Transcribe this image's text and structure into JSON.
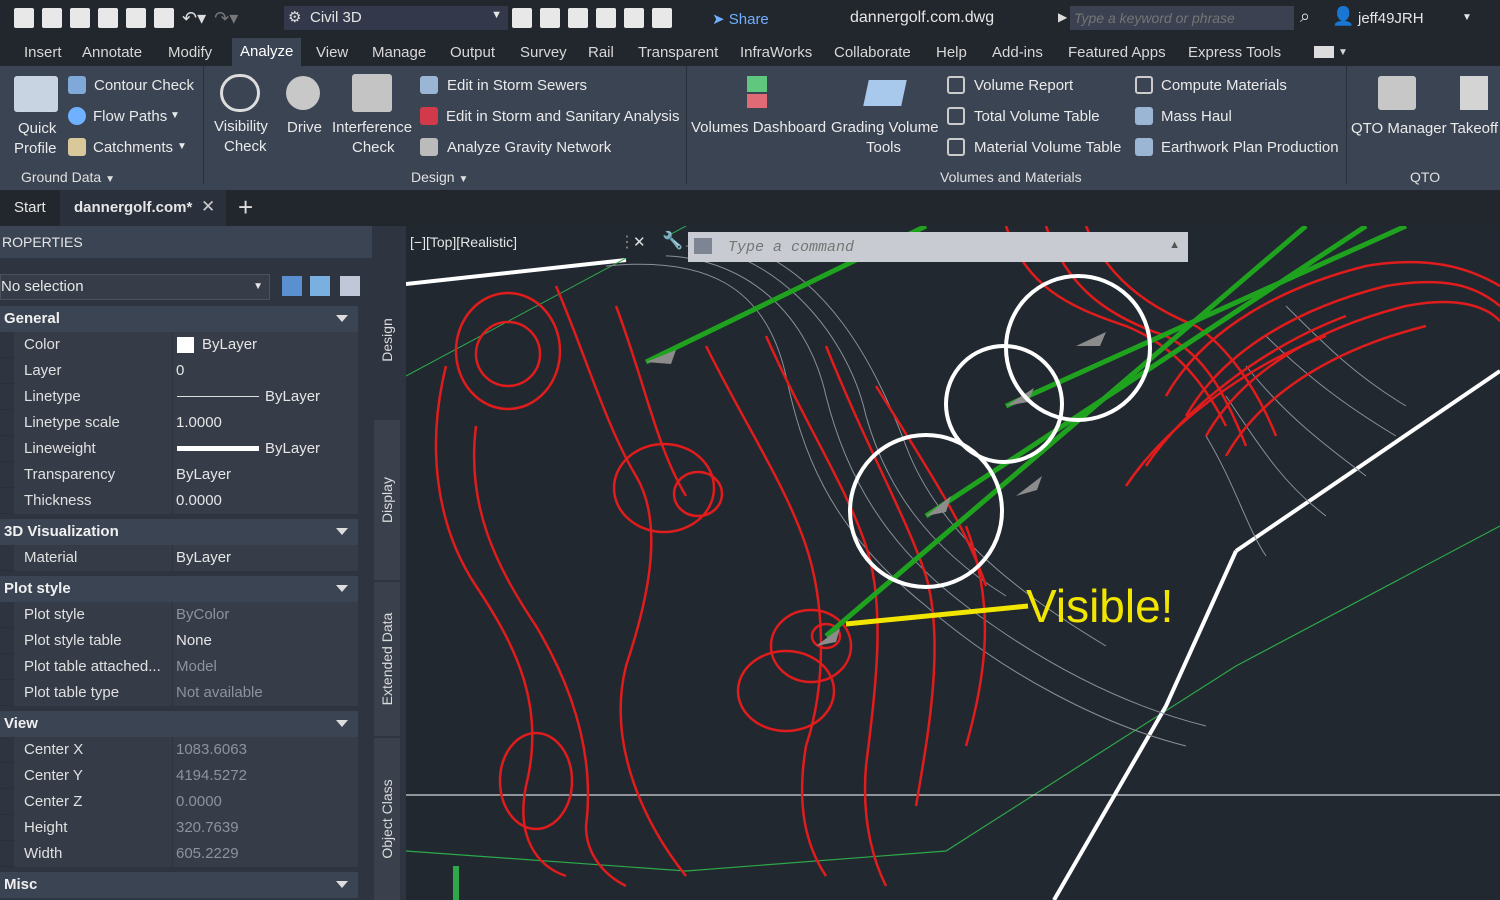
{
  "title_bar": {
    "workspace": "Civil 3D",
    "share": "Share",
    "filename": "dannergolf.com.dwg",
    "search_placeholder": "Type a keyword or phrase",
    "user": "jeff49JRH"
  },
  "menu": [
    "Insert",
    "Annotate",
    "Modify",
    "Analyze",
    "View",
    "Manage",
    "Output",
    "Survey",
    "Rail",
    "Transparent",
    "InfraWorks",
    "Collaborate",
    "Help",
    "Add-ins",
    "Featured Apps",
    "Express Tools"
  ],
  "menu_active": "Analyze",
  "ribbon": {
    "ground_data": {
      "quick_profile_1": "Quick",
      "quick_profile_2": "Profile",
      "contour_check": "Contour Check",
      "flow_paths": "Flow Paths",
      "catchments": "Catchments",
      "panel": "Ground Data"
    },
    "design": {
      "visibility_1": "Visibility",
      "visibility_2": "Check",
      "drive": "Drive",
      "interference_1": "Interference",
      "interference_2": "Check",
      "storm_sewers": "Edit in Storm Sewers",
      "storm_sanitary": "Edit in Storm and Sanitary Analysis",
      "gravity": "Analyze Gravity Network",
      "panel": "Design"
    },
    "volumes": {
      "dashboard": "Volumes Dashboard",
      "grading_1": "Grading Volume",
      "grading_2": "Tools",
      "volume_report": "Volume Report",
      "total_volume": "Total Volume Table",
      "material_volume": "Material Volume Table",
      "compute_materials": "Compute Materials",
      "mass_haul": "Mass Haul",
      "earthwork": "Earthwork Plan Production",
      "panel": "Volumes and Materials"
    },
    "qto": {
      "manager": "QTO Manager",
      "takeoff": "Takeoff",
      "panel": "QTO"
    }
  },
  "doc_tabs": {
    "start": "Start",
    "active": "dannergolf.com*"
  },
  "properties": {
    "title": "ROPERTIES",
    "selection": "No selection",
    "categories": {
      "general": "General",
      "viz": "3D Visualization",
      "plot": "Plot style",
      "view": "View",
      "misc": "Misc"
    },
    "general": [
      {
        "k": "Color",
        "v": "ByLayer"
      },
      {
        "k": "Layer",
        "v": "0"
      },
      {
        "k": "Linetype",
        "v": "ByLayer"
      },
      {
        "k": "Linetype scale",
        "v": "1.0000"
      },
      {
        "k": "Lineweight",
        "v": "ByLayer"
      },
      {
        "k": "Transparency",
        "v": "ByLayer"
      },
      {
        "k": "Thickness",
        "v": "0.0000"
      }
    ],
    "viz": [
      {
        "k": "Material",
        "v": "ByLayer"
      }
    ],
    "plot": [
      {
        "k": "Plot style",
        "v": "ByColor"
      },
      {
        "k": "Plot style table",
        "v": "None"
      },
      {
        "k": "Plot table attached...",
        "v": "Model"
      },
      {
        "k": "Plot table type",
        "v": "Not available"
      }
    ],
    "view": [
      {
        "k": "Center X",
        "v": "1083.6063"
      },
      {
        "k": "Center Y",
        "v": "4194.5272"
      },
      {
        "k": "Center Z",
        "v": "0.0000"
      },
      {
        "k": "Height",
        "v": "320.7639"
      },
      {
        "k": "Width",
        "v": "605.2229"
      }
    ]
  },
  "side_tabs": [
    "Design",
    "Display",
    "Extended Data",
    "Object Class"
  ],
  "viewport": {
    "label": "[−][Top][Realistic]",
    "command_placeholder": "Type a command",
    "annotation": "Visible!"
  }
}
